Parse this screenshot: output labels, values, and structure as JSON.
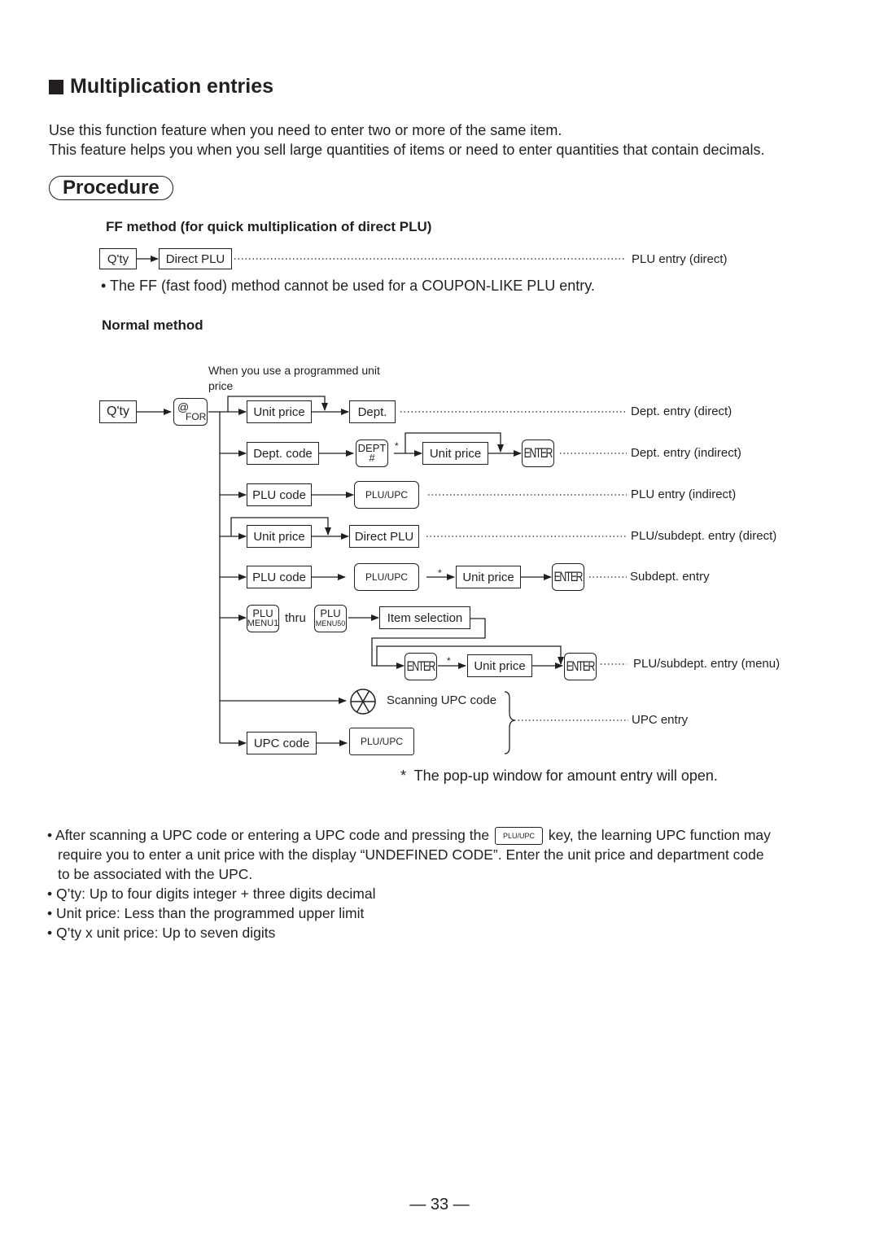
{
  "title": "Multiplication entries",
  "intro": [
    "Use this function feature when you need to enter two or more of the same item.",
    "This feature helps you when you sell large quantities of items or need to enter quantities that contain decimals."
  ],
  "procedure_label": "Procedure",
  "ff_method": {
    "heading": "FF method (for quick multiplication of direct PLU)",
    "qty": "Q'ty",
    "direct_plu": "Direct PLU",
    "result": "PLU entry (direct)",
    "note": "• The FF (fast food) method cannot be used for a COUPON-LIKE PLU entry."
  },
  "normal_method": {
    "heading": "Normal method",
    "programmed_note": "When you use a programmed unit price",
    "qty": "Q'ty",
    "at_for_key": {
      "top": "@",
      "bottom": "FOR"
    },
    "rows": {
      "r1": {
        "box1": "Unit price",
        "box2": "Dept.",
        "result": "Dept. entry (direct)"
      },
      "r2": {
        "box1": "Dept. code",
        "key": {
          "top": "DEPT",
          "bottom": "#"
        },
        "box2": "Unit price",
        "enter": "ENTER",
        "result": "Dept. entry (indirect)"
      },
      "r3": {
        "box1": "PLU code",
        "key": "PLU/UPC",
        "result": "PLU entry (indirect)"
      },
      "r4": {
        "box1": "Unit price",
        "box2": "Direct PLU",
        "result": "PLU/subdept. entry (direct)"
      },
      "r5": {
        "box1": "PLU code",
        "key": "PLU/UPC",
        "box2": "Unit price",
        "enter": "ENTER",
        "result": "Subdept. entry"
      },
      "r6": {
        "key1": {
          "top": "PLU",
          "bottom": "MENU1"
        },
        "thru": "thru",
        "key2": {
          "top": "PLU",
          "bottom": "MENU50"
        },
        "box1": "Item selection"
      },
      "r7": {
        "enter1": "ENTER",
        "box1": "Unit price",
        "enter2": "ENTER",
        "result": "PLU/subdept. entry (menu)"
      },
      "r8": {
        "scan_label": "Scanning UPC code"
      },
      "r9": {
        "box1": "UPC code",
        "key": "PLU/UPC"
      },
      "upc_result": "UPC entry"
    },
    "asterisk": "*",
    "footnote": "*  The pop-up window for amount entry will open."
  },
  "bullets": {
    "b1_pre": "• After scanning a UPC code or entering a UPC code and pressing the",
    "b1_key": "PLU/UPC",
    "b1_post": "key, the learning UPC function may",
    "b1_line2": "require you to enter a unit price with the display “UNDEFINED CODE”.  Enter the unit price and department code",
    "b1_line3": "to be associated with the UPC.",
    "b2": "• Q’ty: Up to four digits integer + three digits decimal",
    "b3": "• Unit price: Less than the programmed upper limit",
    "b4": "• Q’ty x unit price: Up to seven digits"
  },
  "page_number": "— 33 —"
}
